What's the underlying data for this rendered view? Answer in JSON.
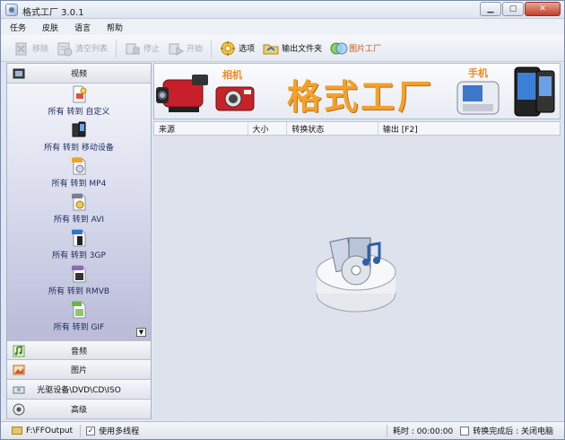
{
  "window": {
    "title": "格式工厂 3.0.1"
  },
  "menu": [
    "任务",
    "皮肤",
    "语言",
    "帮助"
  ],
  "toolbar": {
    "remove": "移除",
    "clear_list": "清空列表",
    "stop": "停止",
    "start": "开始",
    "options": "选项",
    "output_folder": "输出文件夹",
    "picture_factory": "图片工厂"
  },
  "sidebar": {
    "video": "视频",
    "audio": "音频",
    "picture": "图片",
    "rom": "光驱设备\\DVD\\CD\\ISO",
    "advanced": "高级",
    "video_formats": [
      {
        "label": "所有 转到 自定义",
        "badge": ""
      },
      {
        "label": "所有 转到 移动设备",
        "badge": ""
      },
      {
        "label": "所有 转到 MP4",
        "badge": "MP4"
      },
      {
        "label": "所有 转到 AVI",
        "badge": "AVI"
      },
      {
        "label": "所有 转到 3GP",
        "badge": "3GP"
      },
      {
        "label": "所有 转到 RMVB",
        "badge": "RMVB"
      },
      {
        "label": "所有 转到 GIF",
        "badge": "GIF"
      }
    ]
  },
  "banner": {
    "title": "格式工厂",
    "camera_label": "相机",
    "phone_label": "手机"
  },
  "list": {
    "col_source": "来源",
    "col_size": "大小",
    "col_status": "转换状态",
    "col_output": "输出 [F2]"
  },
  "status": {
    "output_path": "F:\\FFOutput",
    "multithread_label": "使用多线程",
    "elapsed": "耗时 : 00:00:00",
    "after_done": "转换完成后 : 关闭电脑"
  },
  "colors": {
    "banner_title": "#f2a12a",
    "accent": "#f08a1e",
    "sidebar_grad_end": "#b9bbd8"
  }
}
